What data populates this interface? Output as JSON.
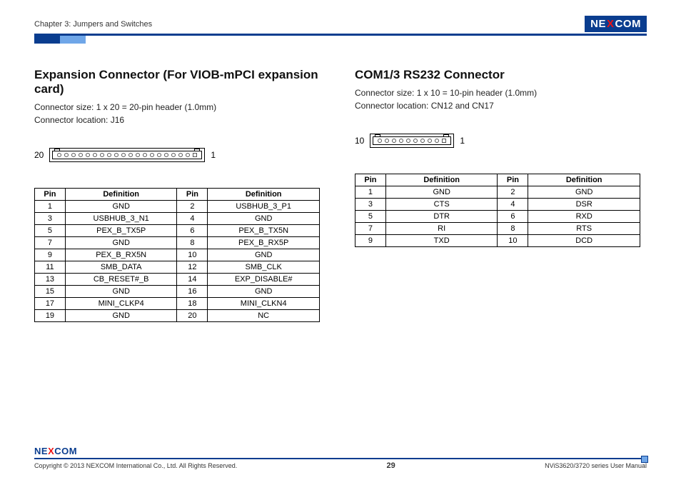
{
  "header": {
    "chapter": "Chapter 3: Jumpers and Switches",
    "logo_pre": "NE",
    "logo_x": "X",
    "logo_post": "COM"
  },
  "left": {
    "title": "Expansion Connector (For VIOB-mPCI expansion card)",
    "line1": "Connector size: 1 x 20 = 20-pin header (1.0mm)",
    "line2": "Connector location: J16",
    "label_left": "20",
    "label_right": "1",
    "th_pin": "Pin",
    "th_def": "Definition",
    "rows": [
      {
        "p1": "1",
        "d1": "GND",
        "p2": "2",
        "d2": "USBHUB_3_P1"
      },
      {
        "p1": "3",
        "d1": "USBHUB_3_N1",
        "p2": "4",
        "d2": "GND"
      },
      {
        "p1": "5",
        "d1": "PEX_B_TX5P",
        "p2": "6",
        "d2": "PEX_B_TX5N"
      },
      {
        "p1": "7",
        "d1": "GND",
        "p2": "8",
        "d2": "PEX_B_RX5P"
      },
      {
        "p1": "9",
        "d1": "PEX_B_RX5N",
        "p2": "10",
        "d2": "GND"
      },
      {
        "p1": "11",
        "d1": "SMB_DATA",
        "p2": "12",
        "d2": "SMB_CLK"
      },
      {
        "p1": "13",
        "d1": "CB_RESET#_B",
        "p2": "14",
        "d2": "EXP_DISABLE#"
      },
      {
        "p1": "15",
        "d1": "GND",
        "p2": "16",
        "d2": "GND"
      },
      {
        "p1": "17",
        "d1": "MINI_CLKP4",
        "p2": "18",
        "d2": "MINI_CLKN4"
      },
      {
        "p1": "19",
        "d1": "GND",
        "p2": "20",
        "d2": "NC"
      }
    ]
  },
  "right": {
    "title": "COM1/3 RS232 Connector",
    "line1": "Connector size: 1 x 10 = 10-pin header (1.0mm)",
    "line2": "Connector location: CN12 and CN17",
    "label_left": "10",
    "label_right": "1",
    "th_pin": "Pin",
    "th_def": "Definition",
    "rows": [
      {
        "p1": "1",
        "d1": "GND",
        "p2": "2",
        "d2": "GND"
      },
      {
        "p1": "3",
        "d1": "CTS",
        "p2": "4",
        "d2": "DSR"
      },
      {
        "p1": "5",
        "d1": "DTR",
        "p2": "6",
        "d2": "RXD"
      },
      {
        "p1": "7",
        "d1": "RI",
        "p2": "8",
        "d2": "RTS"
      },
      {
        "p1": "9",
        "d1": "TXD",
        "p2": "10",
        "d2": "DCD"
      }
    ]
  },
  "footer": {
    "copyright": "Copyright © 2013 NEXCOM International Co., Ltd. All Rights Reserved.",
    "page": "29",
    "manual": "NViS3620/3720 series User Manual",
    "logo_pre": "NE",
    "logo_x": "X",
    "logo_post": "COM"
  }
}
